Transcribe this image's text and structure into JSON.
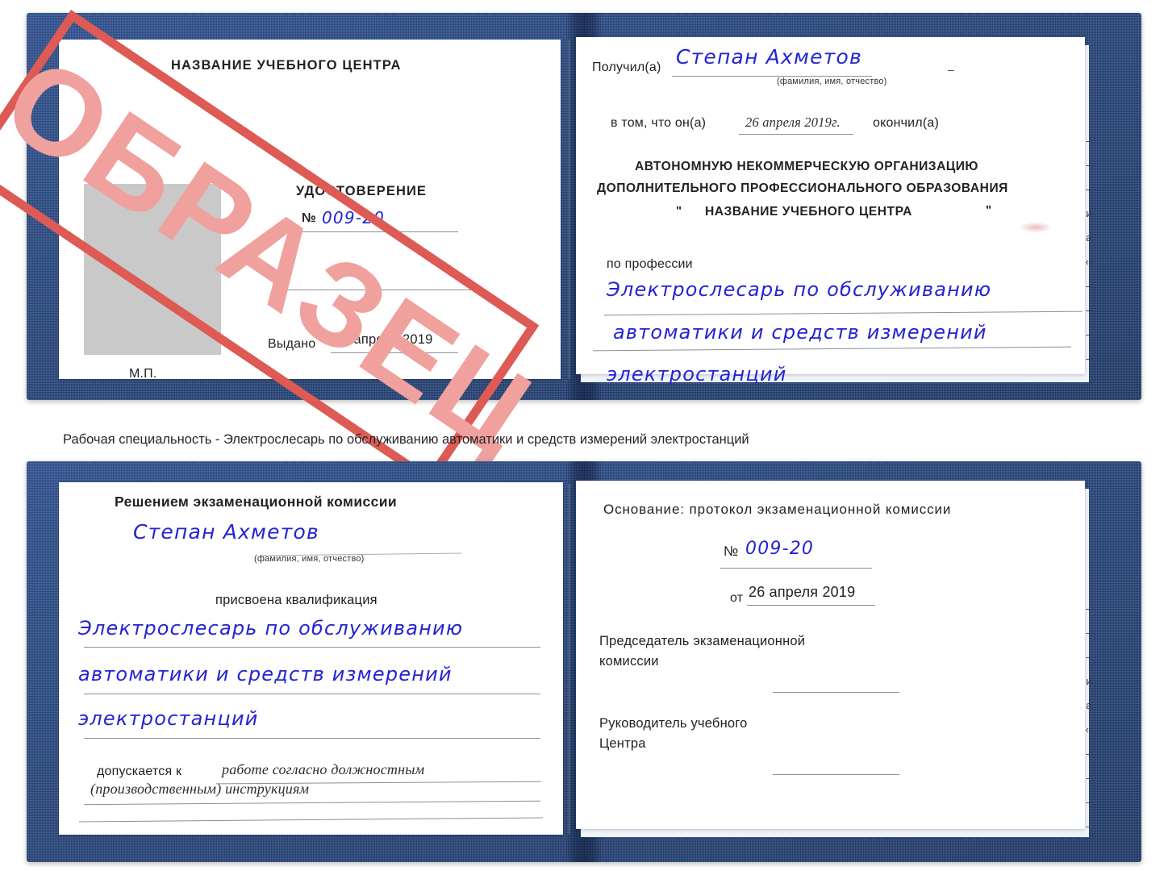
{
  "document": {
    "kind": "Удостоверение",
    "caption": "Рабочая специальность - Электрослесарь по обслуживанию автоматики и средств измерений электростанций"
  },
  "stamp": {
    "text": "ОБРАЗЕЦ",
    "frame_color": "#dd5a55",
    "text_color": "#f0a09d"
  },
  "colors": {
    "cover_blue": "#27477f",
    "handwriting_blue": "#2323d6",
    "paper_white": "#ffffff",
    "photo_placeholder_gray": "#c9c9c9",
    "rule_gray": "#8b8f95"
  },
  "spread_top": {
    "left_page": {
      "center_name": "НАЗВАНИЕ УЧЕБНОГО ЦЕНТРА",
      "title": "УДОСТОВЕРЕНИЕ",
      "number_label": "№",
      "number_value": "009-20",
      "issued_label": "Выдано",
      "issued_value": "26 апреля 2019",
      "seal_label": "М.П.",
      "photo_placeholder": "photo-area"
    },
    "right_page": {
      "received_label": "Получил(а)",
      "received_value": "Степан Ахметов",
      "received_hint": "(фамилия, имя, отчество)",
      "in_that_label": "в том, что он(а)",
      "completion_date": "26 апреля 2019г.",
      "finished_label": "окончил(а)",
      "org_line1": "АВТОНОМНУЮ НЕКОММЕРЧЕСКУЮ ОРГАНИЗАЦИЮ",
      "org_line2": "ДОПОЛНИТЕЛЬНОГО ПРОФЕССИОНАЛЬНОГО ОБРАЗОВАНИЯ",
      "org_quote_open": "\"",
      "org_line3": "НАЗВАНИЕ УЧЕБНОГО ЦЕНТРА",
      "org_quote_close": "\"",
      "profession_label": "по профессии",
      "profession_line1": "Электрослесарь по обслуживанию",
      "profession_line2": "автоматики и средств измерений",
      "profession_line3": "электростанций",
      "edge_glyphs": [
        "–",
        "–",
        "–",
        "и",
        "а",
        "‹-",
        "–",
        "–",
        "–",
        "–"
      ]
    }
  },
  "spread_bottom": {
    "left_page": {
      "heading": "Решением экзаменационной комиссии",
      "name_value": "Степан Ахметов",
      "name_hint": "(фамилия, имя, отчество)",
      "qualification_label": "присвоена квалификация",
      "qualification_line1": "Электрослесарь по обслуживанию",
      "qualification_line2": "автоматики и средств измерений",
      "qualification_line3": "электростанций",
      "admitted_label": "допускается к",
      "admitted_line1": "работе согласно должностным",
      "admitted_line2": "(производственным) инструкциям"
    },
    "right_page": {
      "basis_label": "Основание: протокол экзаменационной комиссии",
      "number_label": "№",
      "number_value": "009-20",
      "date_label": "от",
      "date_value": "26 апреля 2019",
      "chairman_line1": "Председатель экзаменационной",
      "chairman_line2": "комиссии",
      "head_line1": "Руководитель учебного",
      "head_line2": "Центра",
      "edge_glyphs": [
        "–",
        "–",
        "–",
        "и",
        "а",
        "‹-",
        "–",
        "–",
        "–",
        "–"
      ]
    }
  }
}
